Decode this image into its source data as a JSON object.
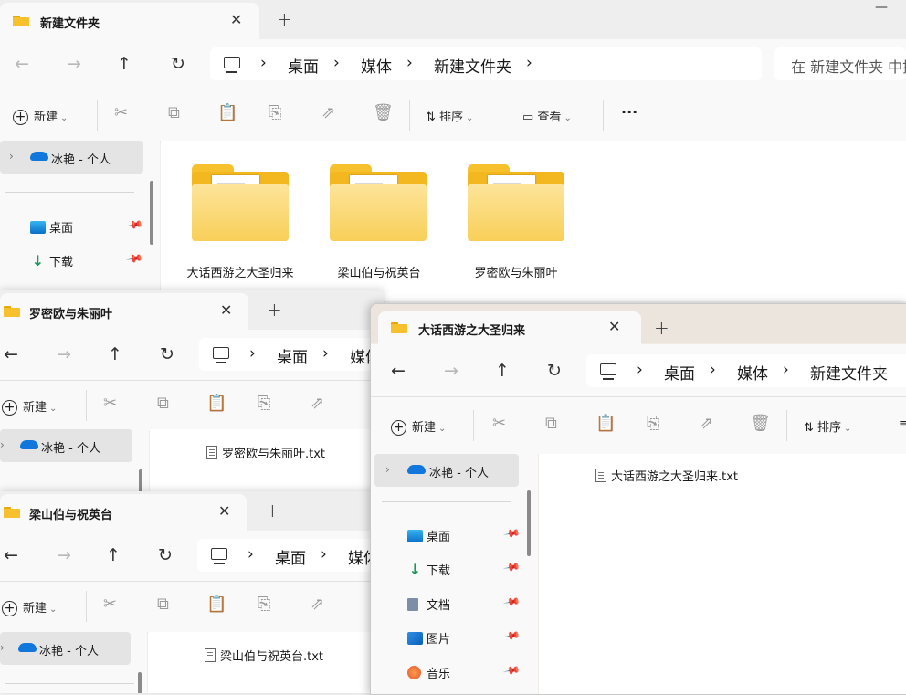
{
  "windows": {
    "main": {
      "tab_title": "新建文件夹",
      "crumbs": [
        "桌面",
        "媒体",
        "新建文件夹"
      ],
      "search_placeholder": "在 新建文件夹 中搜",
      "folders": [
        {
          "name": "大话西游之大圣归来"
        },
        {
          "name": "梁山伯与祝英台"
        },
        {
          "name": "罗密欧与朱丽叶"
        }
      ]
    },
    "romeo": {
      "tab_title": "罗密欧与朱丽叶",
      "crumbs": [
        "桌面",
        "媒体"
      ],
      "file": "罗密欧与朱丽叶.txt"
    },
    "liang": {
      "tab_title": "梁山伯与祝英台",
      "crumbs": [
        "桌面",
        "媒体"
      ],
      "file": "梁山伯与祝英台.txt"
    },
    "dahua": {
      "tab_title": "大话西游之大圣归来",
      "crumbs": [
        "桌面",
        "媒体",
        "新建文件夹"
      ],
      "file": "大话西游之大圣归来.txt"
    }
  },
  "toolbar": {
    "new_label": "新建",
    "sort_label": "排序",
    "view_label": "查看",
    "more_label": "···"
  },
  "navpane": {
    "onedrive_label": "冰艳 - 个人",
    "quick_access": [
      {
        "label": "桌面",
        "icon": "desktop-icon"
      },
      {
        "label": "下载",
        "icon": "download-icon"
      },
      {
        "label": "文档",
        "icon": "documents-icon"
      },
      {
        "label": "图片",
        "icon": "pictures-icon"
      },
      {
        "label": "音乐",
        "icon": "music-icon"
      }
    ]
  },
  "colors": {
    "folder": "#f3b720",
    "accent": "#1177dd",
    "window_bg": "#f9f9f9"
  }
}
